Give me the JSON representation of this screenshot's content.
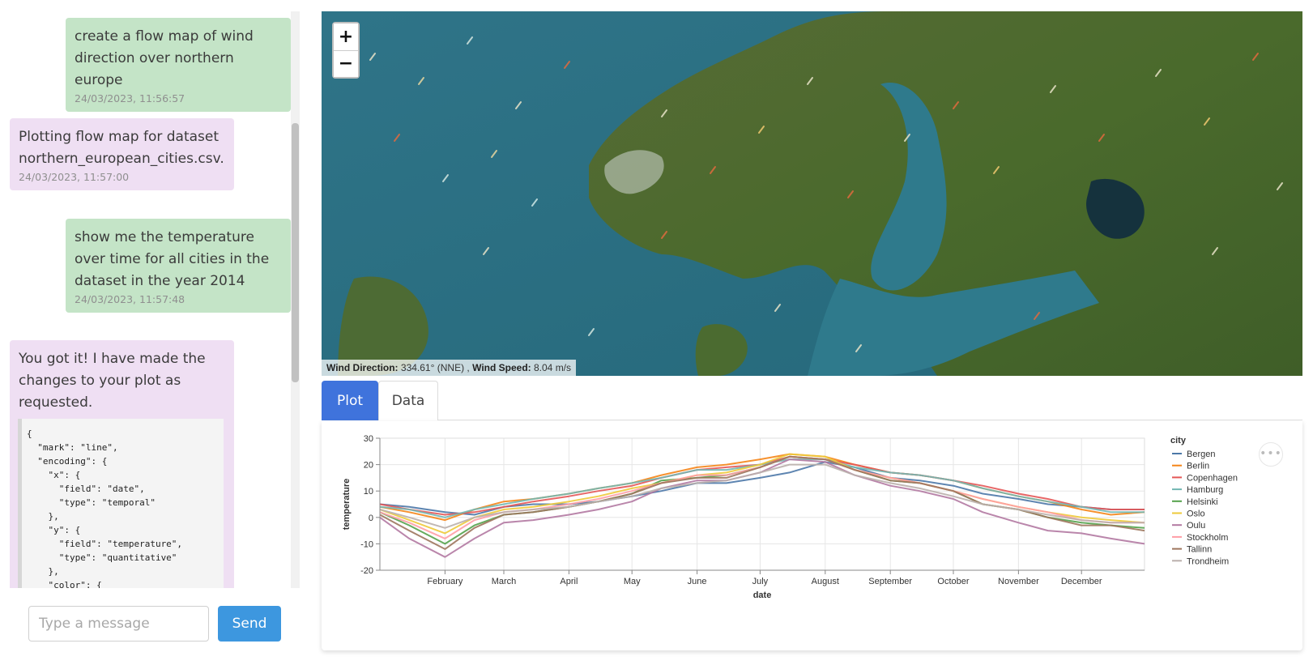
{
  "chat": {
    "messages": [
      {
        "role": "user",
        "text": "create a flow map of wind direction over northern europe",
        "timestamp": "24/03/2023, 11:56:57"
      },
      {
        "role": "bot",
        "text": "Plotting flow map for dataset northern_european_cities.csv.",
        "timestamp": "24/03/2023, 11:57:00"
      },
      {
        "role": "user",
        "text": "show me the temperature over time for all cities in the dataset in the year 2014",
        "timestamp": "24/03/2023, 11:57:48"
      },
      {
        "role": "bot",
        "text": "You got it! I have made the changes to your plot as requested.",
        "code": "{\n  \"mark\": \"line\",\n  \"encoding\": {\n    \"x\": {\n      \"field\": \"date\",\n      \"type\": \"temporal\"\n    },\n    \"y\": {\n      \"field\": \"temperature\",\n      \"type\": \"quantitative\"\n    },\n    \"color\": {"
      }
    ],
    "input_placeholder": "Type a message",
    "send_label": "Send"
  },
  "map": {
    "zoom_in": "+",
    "zoom_out": "−",
    "readout": {
      "dir_label": "Wind Direction:",
      "dir_value": "334.61° (NNE) ,",
      "speed_label": "Wind Speed:",
      "speed_value": "8.04 m/s"
    }
  },
  "tabs": [
    {
      "label": "Plot",
      "active": true
    },
    {
      "label": "Data",
      "active": false
    }
  ],
  "more_icon": "ellipsis-icon",
  "chart_data": {
    "type": "line",
    "xlabel": "date",
    "ylabel": "temperature",
    "ylim": [
      -20,
      30
    ],
    "yticks": [
      30,
      20,
      10,
      0,
      -10,
      -20
    ],
    "xlim": [
      "2014-01-01",
      "2014-12-31"
    ],
    "x_ticks": [
      {
        "label": "February",
        "date": "2014-02-01"
      },
      {
        "label": "March",
        "date": "2014-03-01"
      },
      {
        "label": "April",
        "date": "2014-04-01"
      },
      {
        "label": "May",
        "date": "2014-05-01"
      },
      {
        "label": "June",
        "date": "2014-06-01"
      },
      {
        "label": "July",
        "date": "2014-07-01"
      },
      {
        "label": "August",
        "date": "2014-08-01"
      },
      {
        "label": "September",
        "date": "2014-09-01"
      },
      {
        "label": "October",
        "date": "2014-10-01"
      },
      {
        "label": "November",
        "date": "2014-11-01"
      },
      {
        "label": "December",
        "date": "2014-12-01"
      }
    ],
    "grid": true,
    "legend": {
      "title": "city",
      "position": "right"
    },
    "series_dates": [
      "2014-01-01",
      "2014-01-15",
      "2014-02-01",
      "2014-02-15",
      "2014-03-01",
      "2014-03-15",
      "2014-04-01",
      "2014-04-15",
      "2014-05-01",
      "2014-05-15",
      "2014-06-01",
      "2014-06-15",
      "2014-07-01",
      "2014-07-15",
      "2014-08-01",
      "2014-08-15",
      "2014-09-01",
      "2014-09-15",
      "2014-10-01",
      "2014-10-15",
      "2014-11-01",
      "2014-11-15",
      "2014-12-01",
      "2014-12-15",
      "2014-12-31"
    ],
    "series": [
      {
        "name": "Bergen",
        "color": "#4c78a8",
        "values": [
          5,
          4,
          2,
          1,
          4,
          5,
          5,
          6,
          8,
          10,
          13,
          13,
          15,
          17,
          21,
          19,
          15,
          14,
          12,
          9,
          7,
          5,
          4,
          3,
          3
        ]
      },
      {
        "name": "Berlin",
        "color": "#f58518",
        "values": [
          4,
          2,
          -1,
          3,
          6,
          7,
          9,
          11,
          13,
          16,
          19,
          20,
          22,
          24,
          23,
          20,
          17,
          16,
          14,
          11,
          8,
          6,
          3,
          1,
          2
        ]
      },
      {
        "name": "Copenhagen",
        "color": "#e45756",
        "values": [
          5,
          3,
          1,
          2,
          4,
          6,
          8,
          10,
          12,
          15,
          18,
          19,
          20,
          23,
          22,
          20,
          17,
          16,
          14,
          12,
          9,
          7,
          4,
          3,
          3
        ]
      },
      {
        "name": "Hamburg",
        "color": "#72b7b2",
        "values": [
          4,
          3,
          0,
          3,
          5,
          7,
          9,
          11,
          13,
          15,
          18,
          18,
          20,
          22,
          22,
          19,
          17,
          16,
          14,
          11,
          8,
          6,
          4,
          2,
          2
        ]
      },
      {
        "name": "Helsinki",
        "color": "#54a24b",
        "values": [
          2,
          -3,
          -10,
          -3,
          1,
          2,
          4,
          6,
          9,
          14,
          15,
          16,
          19,
          23,
          22,
          18,
          14,
          13,
          10,
          5,
          3,
          0,
          -2,
          -3,
          -4
        ]
      },
      {
        "name": "Oslo",
        "color": "#eeca3b",
        "values": [
          3,
          -1,
          -6,
          0,
          3,
          4,
          6,
          8,
          11,
          13,
          16,
          17,
          20,
          24,
          23,
          18,
          15,
          13,
          10,
          7,
          4,
          2,
          0,
          -1,
          -2
        ]
      },
      {
        "name": "Oulu",
        "color": "#b279a2",
        "values": [
          0,
          -8,
          -15,
          -8,
          -2,
          -1,
          1,
          3,
          6,
          11,
          14,
          14,
          17,
          22,
          21,
          16,
          12,
          10,
          7,
          2,
          -2,
          -5,
          -6,
          -8,
          -10
        ]
      },
      {
        "name": "Stockholm",
        "color": "#ff9da6",
        "values": [
          2,
          -2,
          -8,
          -1,
          2,
          3,
          5,
          7,
          10,
          13,
          16,
          16,
          19,
          23,
          22,
          18,
          15,
          13,
          10,
          7,
          4,
          2,
          -1,
          -2,
          -2
        ]
      },
      {
        "name": "Tallinn",
        "color": "#9d755d",
        "values": [
          1,
          -5,
          -12,
          -4,
          1,
          2,
          4,
          6,
          9,
          13,
          15,
          15,
          19,
          23,
          22,
          18,
          14,
          13,
          10,
          5,
          3,
          0,
          -3,
          -3,
          -5
        ]
      },
      {
        "name": "Trondheim",
        "color": "#bab0ac",
        "values": [
          3,
          0,
          -4,
          0,
          2,
          3,
          4,
          6,
          8,
          11,
          13,
          14,
          17,
          20,
          20,
          16,
          13,
          11,
          8,
          5,
          3,
          1,
          -1,
          -2,
          -2
        ]
      }
    ]
  }
}
